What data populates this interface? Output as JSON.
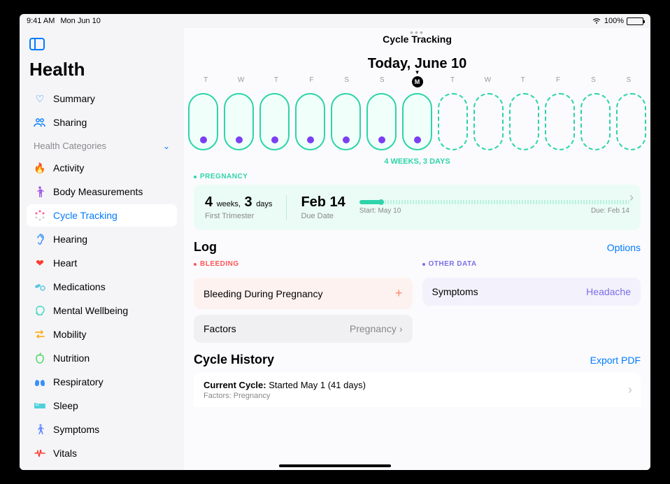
{
  "status": {
    "time": "9:41 AM",
    "date": "Mon Jun 10",
    "battery": "100%"
  },
  "app_title": "Health",
  "nav": {
    "summary": "Summary",
    "sharing": "Sharing",
    "categories_header": "Health Categories",
    "items": [
      {
        "label": "Activity"
      },
      {
        "label": "Body Measurements"
      },
      {
        "label": "Cycle Tracking"
      },
      {
        "label": "Hearing"
      },
      {
        "label": "Heart"
      },
      {
        "label": "Medications"
      },
      {
        "label": "Mental Wellbeing"
      },
      {
        "label": "Mobility"
      },
      {
        "label": "Nutrition"
      },
      {
        "label": "Respiratory"
      },
      {
        "label": "Sleep"
      },
      {
        "label": "Symptoms"
      },
      {
        "label": "Vitals"
      }
    ]
  },
  "header": {
    "title": "Cycle Tracking",
    "today": "Today, June 10",
    "days": [
      "T",
      "W",
      "T",
      "F",
      "S",
      "S",
      "M",
      "T",
      "W",
      "T",
      "F",
      "S",
      "S"
    ],
    "today_index": 6,
    "cycle_length": "4 WEEKS, 3 DAYS"
  },
  "pregnancy": {
    "tag": "Pregnancy",
    "weeks_num": "4",
    "weeks_unit": "weeks,",
    "days_num": "3",
    "days_unit": "days",
    "trimester": "First Trimester",
    "due_date": "Feb 14",
    "due_label": "Due Date",
    "start_label": "Start: May 10",
    "end_label": "Due: Feb 14"
  },
  "log": {
    "title": "Log",
    "options": "Options",
    "bleeding_tag": "Bleeding",
    "other_tag": "Other Data",
    "bleeding_row": "Bleeding During Pregnancy",
    "factors_label": "Factors",
    "factors_value": "Pregnancy",
    "symptoms_label": "Symptoms",
    "symptoms_value": "Headache"
  },
  "history": {
    "title": "Cycle History",
    "export": "Export PDF",
    "current_bold": "Current Cycle:",
    "current_rest": " Started May 1 (41 days)",
    "factors_label": "Factors: ",
    "factors_value": "Pregnancy"
  }
}
